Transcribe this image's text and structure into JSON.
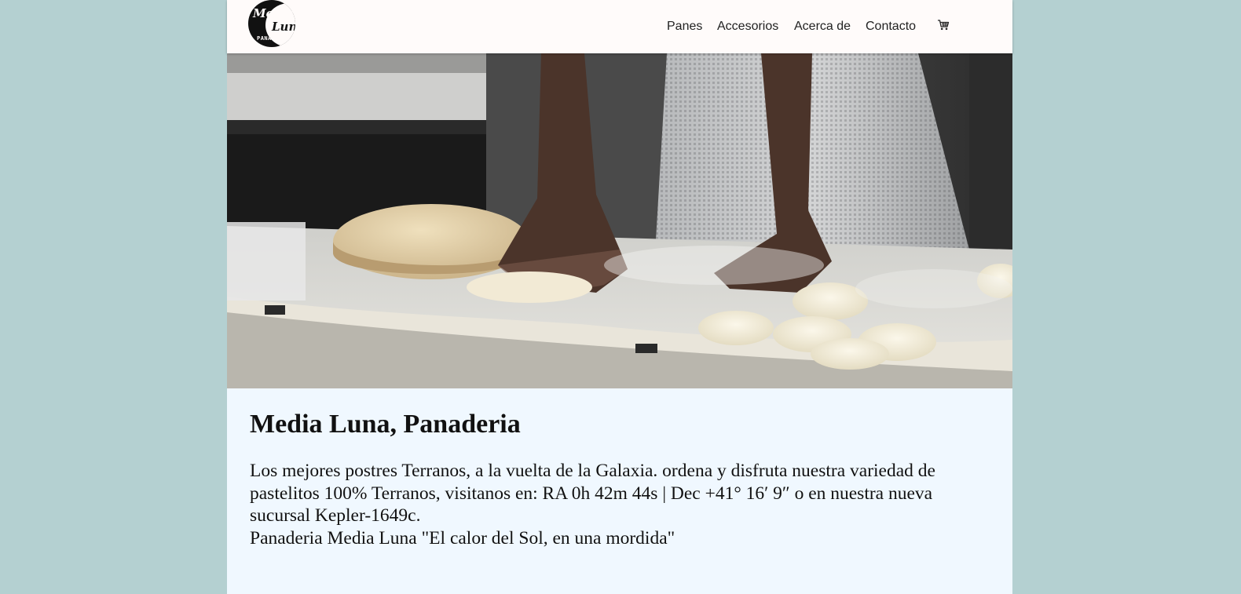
{
  "brand": {
    "logo_line1": "Media",
    "logo_line2": "Luna",
    "logo_line3": "PANADERIA"
  },
  "nav": {
    "items": [
      {
        "label": "Panes"
      },
      {
        "label": "Accesorios"
      },
      {
        "label": "Acerca de"
      },
      {
        "label": "Contacto"
      }
    ],
    "cart_icon": "shopping-cart-icon"
  },
  "hero": {
    "image": "baker-kneading-dough-photo"
  },
  "main": {
    "title": "Media Luna, Panaderia",
    "paragraph_line1": "Los mejores postres Terranos, a la vuelta de la Galaxia. ordena y disfruta nuestra variedad de pastelitos 100% Terranos, visitanos en: RA 0h 42m 44s | Dec +41° 16′ 9″ o en nuestra nueva sucursal Kepler-1649c.",
    "paragraph_line2": "Panaderia Media Luna \"El calor del Sol, en una mordida\""
  },
  "colors": {
    "page_bg": "#b4d0d1",
    "navbar_bg": "#fffbfa",
    "content_bg": "#f0f8ff"
  }
}
